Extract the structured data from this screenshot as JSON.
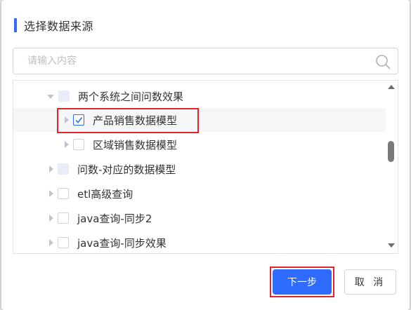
{
  "dialog": {
    "title": "选择数据来源"
  },
  "search": {
    "placeholder": "请输入内容",
    "value": ""
  },
  "tree": {
    "nodes": [
      {
        "label": "两个系统之间问数效果",
        "expanded": true,
        "check_state": "partial"
      },
      {
        "label": "产品销售数据模型",
        "expanded": false,
        "check_state": "checked",
        "selected": true
      },
      {
        "label": "区域销售数据模型",
        "expanded": false,
        "check_state": "unchecked"
      },
      {
        "label": "问数-对应的数据模型",
        "expanded": false,
        "check_state": "partial"
      },
      {
        "label": "etl高级查询",
        "expanded": false,
        "check_state": "unchecked"
      },
      {
        "label": "java查询-同步2",
        "expanded": false,
        "check_state": "unchecked"
      },
      {
        "label": "java查询-同步效果",
        "expanded": false,
        "check_state": "unchecked"
      }
    ]
  },
  "footer": {
    "next_label": "下一步",
    "cancel_label": "取 消"
  },
  "colors": {
    "accent": "#2f6bff",
    "highlight_frame": "#e0252d"
  }
}
